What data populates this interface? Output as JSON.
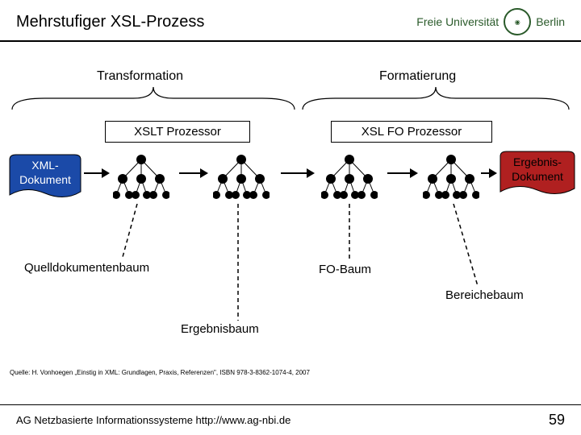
{
  "header": {
    "title": "Mehrstufiger XSL-Prozess",
    "uni_name": "Freie Universität",
    "uni_city": "Berlin"
  },
  "sections": {
    "left": "Transformation",
    "right": "Formatierung"
  },
  "processors": {
    "left": "XSLT Prozessor",
    "right": "XSL FO Prozessor"
  },
  "docs": {
    "xml_l1": "XML-",
    "xml_l2": "Dokument",
    "erg_l1": "Ergebnis-",
    "erg_l2": "Dokument"
  },
  "labels": {
    "quelldoc": "Quelldokumentenbaum",
    "fobaum": "FO-Baum",
    "bereich": "Bereichebaum",
    "ergebnis": "Ergebnisbaum"
  },
  "source": "Quelle: H. Vonhoegen „Einstig in XML: Grundlagen, Praxis, Referenzen\", ISBN 978-3-8362-1074-4, 2007",
  "footer": {
    "org": "AG Netzbasierte Informationssysteme http://www.ag-nbi.de",
    "page": "59"
  },
  "colors": {
    "xml": "#1b4aa8",
    "erg": "#b02020",
    "node": "#000"
  }
}
